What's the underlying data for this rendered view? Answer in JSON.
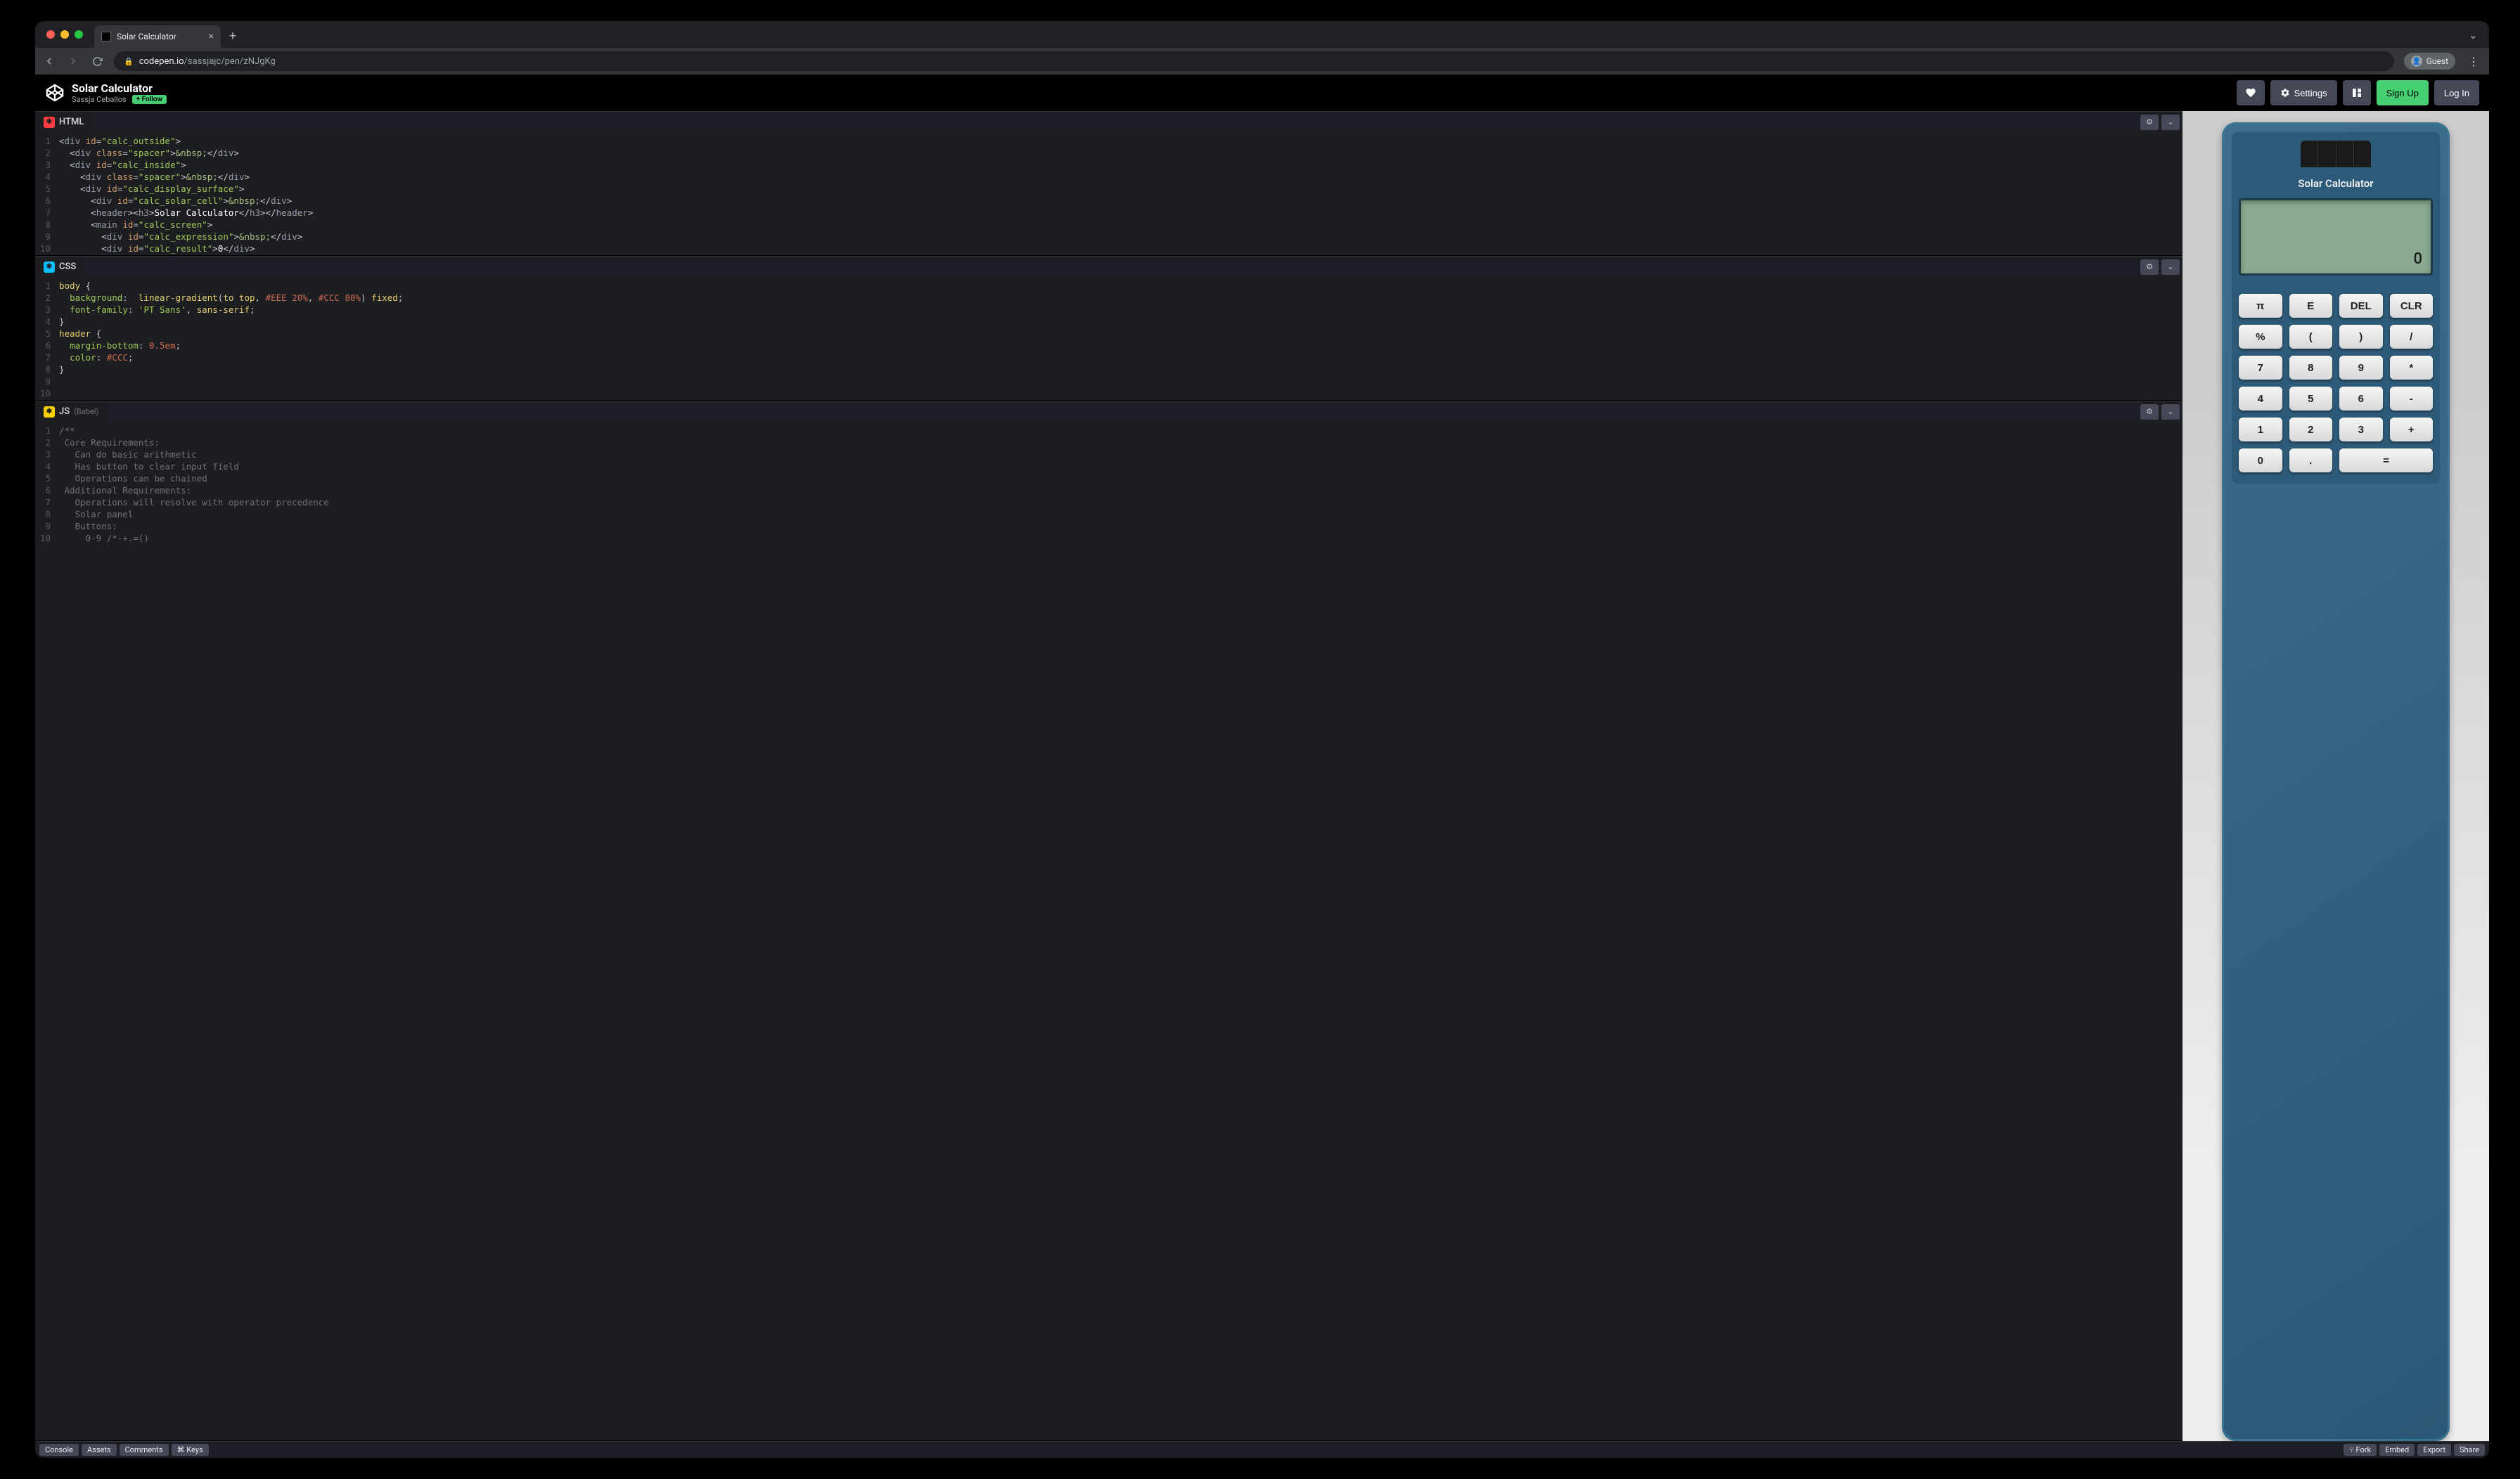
{
  "browser": {
    "tab_title": "Solar Calculator",
    "url_domain": "codepen.io",
    "url_path": "/sassjajc/pen/zNJgKg",
    "guest_label": "Guest"
  },
  "header": {
    "title": "Solar Calculator",
    "author": "Sassja Ceballos",
    "follow_label": "+ Follow",
    "settings_label": "Settings",
    "signup_label": "Sign Up",
    "login_label": "Log In"
  },
  "panes": {
    "html_label": "HTML",
    "css_label": "CSS",
    "js_label": "JS",
    "js_preproc": "(Babel)"
  },
  "html_code": {
    "l1": "<div id=\"calc_outside\">",
    "l2": "  <div class=\"spacer\">&nbsp;</div>",
    "l3": "  <div id=\"calc_inside\">",
    "l4": "    <div class=\"spacer\">&nbsp;</div>",
    "l5": "    <div id=\"calc_display_surface\">",
    "l6": "      <div id=\"calc_solar_cell\">&nbsp;</div>",
    "l7": "      <header><h3>Solar Calculator</h3></header>",
    "l8": "      <main id=\"calc_screen\">",
    "l9": "        <div id=\"calc_expression\">&nbsp;</div>",
    "l10": "        <div id=\"calc_result\">0</div>"
  },
  "css_code": {
    "l1": "body {",
    "l2": "  background:  linear-gradient(to top, #EEE 20%, #CCC 80%) fixed;",
    "l3": "  font-family: 'PT Sans', sans-serif;",
    "l4": "}",
    "l5": "header {",
    "l6": "  margin-bottom: 0.5em;",
    "l7": "  color: #CCC;",
    "l8": "}",
    "l9": "",
    "l10": ""
  },
  "js_code": {
    "l1": "/**",
    "l2": " Core Requirements:",
    "l3": "   Can do basic arithmetic",
    "l4": "   Has button to clear input field",
    "l5": "   Operations can be chained",
    "l6": " Additional Requirements:",
    "l7": "   Operations will resolve with operator precedence",
    "l8": "   Solar panel",
    "l9": "   Buttons:",
    "l10": "     0-9 /*-+.=()"
  },
  "calculator": {
    "title": "Solar Calculator",
    "result": "0",
    "buttons": {
      "pi": "π",
      "e": "E",
      "del": "DEL",
      "clr": "CLR",
      "pct": "%",
      "lparen": "(",
      "rparen": ")",
      "div": "/",
      "b7": "7",
      "b8": "8",
      "b9": "9",
      "mul": "*",
      "b4": "4",
      "b5": "5",
      "b6": "6",
      "sub": "-",
      "b1": "1",
      "b2": "2",
      "b3": "3",
      "add": "+",
      "b0": "0",
      "dot": ".",
      "eq": "="
    }
  },
  "footer": {
    "console": "Console",
    "assets": "Assets",
    "comments": "Comments",
    "keys": "⌘ Keys",
    "fork": "⑂ Fork",
    "embed": "Embed",
    "export": "Export",
    "share": "Share"
  }
}
